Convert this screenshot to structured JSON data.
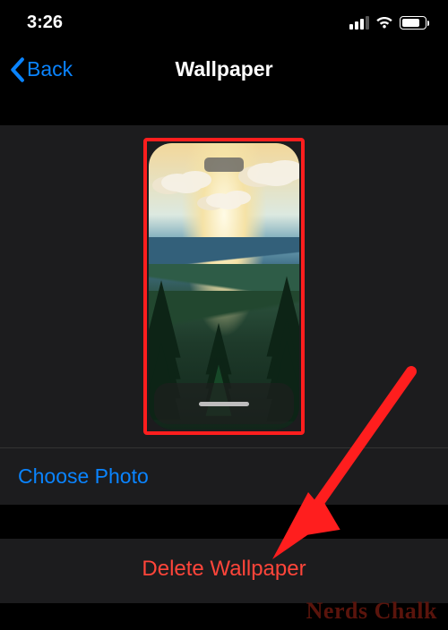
{
  "status": {
    "time": "3:26"
  },
  "nav": {
    "back_label": "Back",
    "title": "Wallpaper"
  },
  "actions": {
    "choose_photo": "Choose Photo",
    "delete_wallpaper": "Delete Wallpaper"
  },
  "watermark": "Nerds Chalk",
  "colors": {
    "accent": "#0A84FF",
    "destructive": "#ff453a",
    "annotation": "#ff1e1e"
  }
}
